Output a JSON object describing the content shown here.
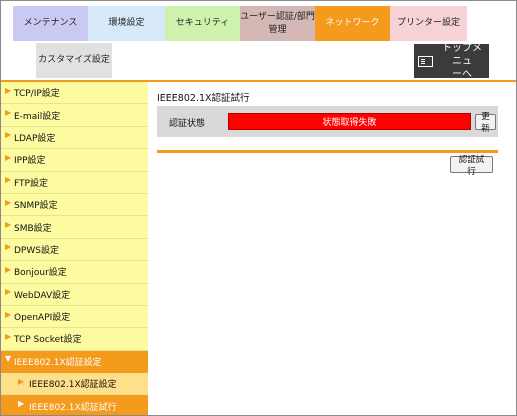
{
  "tabs": {
    "maintenance": "メンテナンス",
    "environment": "環境設定",
    "security": "セキュリティ",
    "user_auth": [
      "ユーザー認証/部門",
      "管理"
    ],
    "network": "ネットワーク",
    "printer": "プリンター設定",
    "customize": "カスタマイズ設定",
    "active": "network"
  },
  "top_menu": {
    "label": [
      "トップメニュ",
      "ーへ"
    ],
    "icon": "menu-list-icon"
  },
  "sidebar": {
    "items": [
      {
        "label": "TCP/IP設定"
      },
      {
        "label": "E-mail設定"
      },
      {
        "label": "LDAP設定"
      },
      {
        "label": "IPP設定"
      },
      {
        "label": "FTP設定"
      },
      {
        "label": "SNMP設定"
      },
      {
        "label": "SMB設定"
      },
      {
        "label": "DPWS設定"
      },
      {
        "label": "Bonjour設定"
      },
      {
        "label": "WebDAV設定"
      },
      {
        "label": "OpenAPI設定"
      },
      {
        "label": "TCP Socket設定"
      },
      {
        "label": "IEEE802.1X認証設定"
      }
    ],
    "sub_items": [
      {
        "label": "IEEE802.1X認証設定"
      },
      {
        "label": "IEEE802.1X認証試行"
      }
    ]
  },
  "main": {
    "title": "IEEE802.1X認証試行",
    "status_label": "認証状態",
    "status_value": "状態取得失敗",
    "refresh_label": "更新",
    "test_auth_label": "認証試行"
  },
  "colors": {
    "accent": "#f49a1c",
    "sidebar_bg": "#fdfba0",
    "status_error": "#ff0000"
  }
}
